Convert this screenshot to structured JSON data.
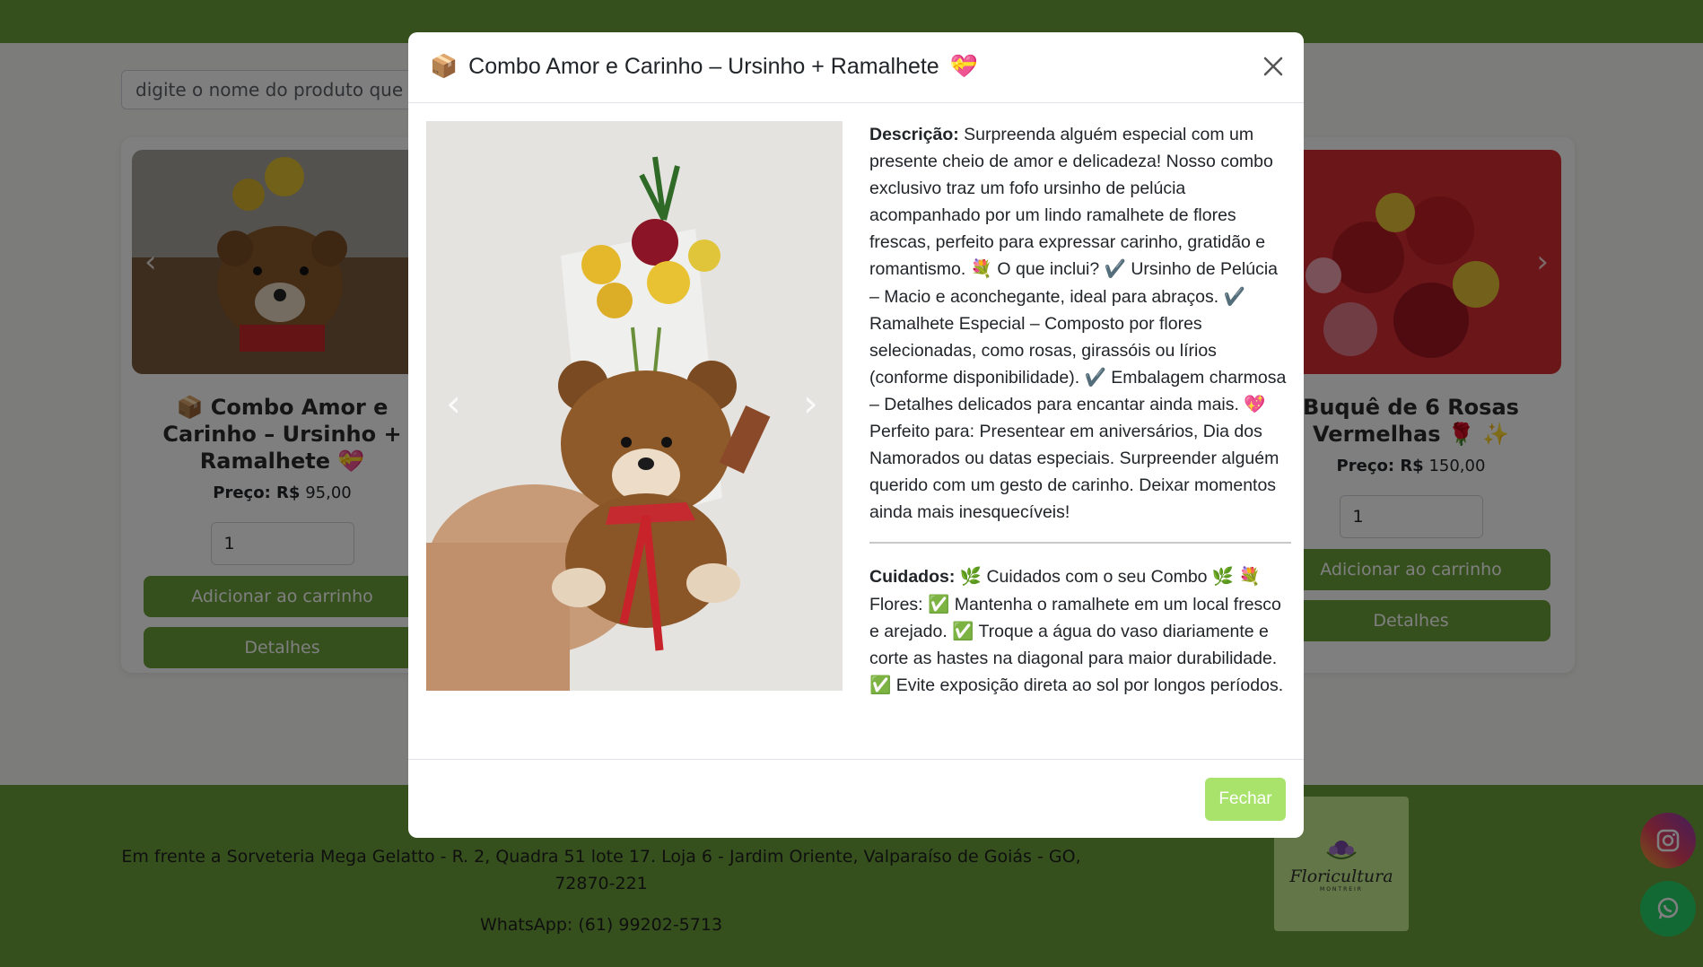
{
  "search": {
    "placeholder": "digite o nome do produto que deseja"
  },
  "products": [
    {
      "title": "📦 Combo Amor e Carinho – Ursinho + Ramalhete 💝",
      "price_label": "Preço: R$",
      "price": "95,00",
      "qty": "1",
      "add_label": "Adicionar ao carrinho",
      "details_label": "Detalhes"
    },
    {
      "title": "Buquê de 6 Rosas Vermelhas 🌹 ✨",
      "price_label": "Preço: R$",
      "price": "150,00",
      "qty": "1",
      "add_label": "Adicionar ao carrinho",
      "details_label": "Detalhes"
    }
  ],
  "footer": {
    "address": "Em frente a Sorveteria Mega Gelatto - R. 2, Quadra 51 lote 17. Loja 6 - Jardim Oriente, Valparaíso de Goiás - GO, 72870-221",
    "whatsapp": "WhatsApp: (61) 99202-5713",
    "logo_text": "Floricultura",
    "logo_sub": "MONTREIR"
  },
  "modal": {
    "title_icon": "📦",
    "title": "Combo Amor e Carinho – Ursinho + Ramalhete",
    "title_emoji": "💝",
    "description_label": "Descrição:",
    "description": "Surpreenda alguém especial com um presente cheio de amor e delicadeza! Nosso combo exclusivo traz um fofo ursinho de pelúcia acompanhado por um lindo ramalhete de flores frescas, perfeito para expressar carinho, gratidão e romantismo. 💐 O que inclui? ✔️ Ursinho de Pelúcia – Macio e aconchegante, ideal para abraços. ✔️ Ramalhete Especial – Composto por flores selecionadas, como rosas, girassóis ou lírios (conforme disponibilidade). ✔️ Embalagem charmosa – Detalhes delicados para encantar ainda mais. 💖 Perfeito para: Presentear em aniversários, Dia dos Namorados ou datas especiais. Surpreender alguém querido com um gesto de carinho. Deixar momentos ainda mais inesquecíveis!",
    "care_label": "Cuidados:",
    "care": "🌿 Cuidados com o seu Combo 🌿 💐 Flores: ✅ Mantenha o ramalhete em um local fresco e arejado. ✅ Troque a água do vaso diariamente e corte as hastes na diagonal para maior durabilidade. ✅ Evite exposição direta ao sol por longos períodos.",
    "close_label": "Fechar"
  }
}
